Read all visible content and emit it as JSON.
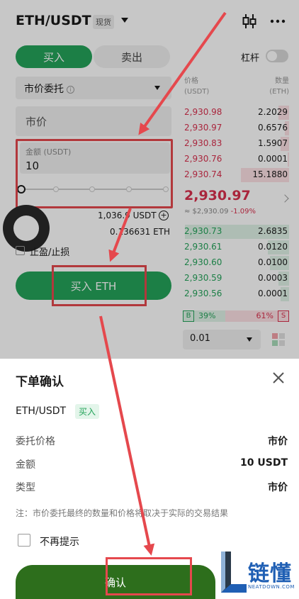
{
  "header": {
    "pair": "ETH/USDT",
    "market_badge": "现货",
    "kline_icon": "candlestick-icon",
    "more_icon": "more-icon"
  },
  "trade": {
    "buy_tab": "买入",
    "sell_tab": "卖出",
    "leverage_label": "杠杆",
    "leverage_enabled": false,
    "order_type": "市价委托",
    "price_field": "市价",
    "amount_label": "金额 (USDT)",
    "amount_value": "10",
    "slider_percent": 0,
    "available_usdt": "1,036.9 USDT",
    "available_eth": "0.136631 ETH",
    "tpsl_label": "止盈/止损",
    "buy_button": "买入 ETH"
  },
  "order_book": {
    "price_header": "价格",
    "price_unit": "(USDT)",
    "qty_header": "数量",
    "qty_unit": "(ETH)",
    "asks": [
      {
        "price": "2,930.98",
        "qty": "2.2029",
        "depth": 0.1
      },
      {
        "price": "2,930.97",
        "qty": "0.6576",
        "depth": 0.04
      },
      {
        "price": "2,930.83",
        "qty": "1.5907",
        "depth": 0.08
      },
      {
        "price": "2,930.76",
        "qty": "0.0001",
        "depth": 0.01
      },
      {
        "price": "2,930.74",
        "qty": "15.1880",
        "depth": 0.45
      }
    ],
    "last_price": "2,930.97",
    "last_fiat": "≈ $2,930.09",
    "last_change": "-1.09%",
    "bids": [
      {
        "price": "2,930.73",
        "qty": "2.6835",
        "depth": 0.98
      },
      {
        "price": "2,930.61",
        "qty": "0.0120",
        "depth": 0.2
      },
      {
        "price": "2,930.60",
        "qty": "0.0100",
        "depth": 0.18
      },
      {
        "price": "2,930.59",
        "qty": "0.0003",
        "depth": 0.1
      },
      {
        "price": "2,930.56",
        "qty": "0.0001",
        "depth": 0.08
      }
    ],
    "buy_ratio_tag": "B",
    "buy_ratio": "39%",
    "sell_ratio": "61%",
    "sell_ratio_tag": "S",
    "depth_precision": "0.01"
  },
  "confirm_sheet": {
    "title": "下单确认",
    "pair": "ETH/USDT",
    "side": "买入",
    "rows": [
      {
        "label": "委托价格",
        "value": "市价"
      },
      {
        "label": "金额",
        "value": "10 USDT"
      },
      {
        "label": "类型",
        "value": "市价"
      }
    ],
    "note": "注：市价委托最终的数量和价格将取决于实际的交易结果",
    "no_remind": "不再提示",
    "confirm_button": "确认"
  },
  "watermark": {
    "brand": "链懂",
    "domain": "NEATDOWN.COM"
  },
  "colors": {
    "buy_green": "#24a35a",
    "sell_red": "#d9304e",
    "confirm_green": "#2d6e1c",
    "highlight_red": "#e5484d",
    "brand_blue": "#1f5fb4"
  }
}
